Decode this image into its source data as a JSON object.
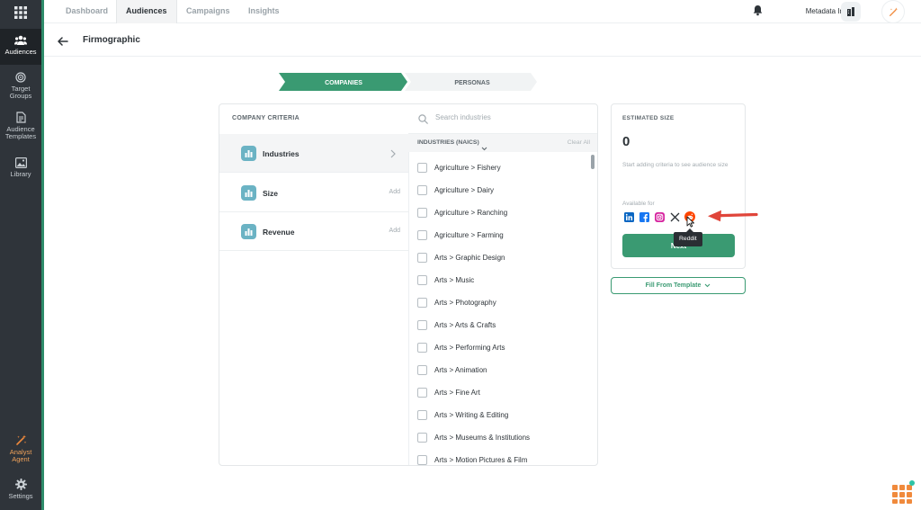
{
  "rail": {
    "items": [
      {
        "label": "Audiences"
      },
      {
        "label": "Target\nGroups"
      },
      {
        "label": "Audience\nTemplates"
      },
      {
        "label": "Library"
      },
      {
        "label": "Analyst\nAgent"
      },
      {
        "label": "Settings"
      }
    ]
  },
  "topnav": {
    "tabs": [
      "Dashboard",
      "Audiences",
      "Campaigns",
      "Insights"
    ],
    "org_name": "Metadata Inc"
  },
  "header": {
    "title": "Firmographic"
  },
  "steps": [
    "COMPANIES",
    "PERSONAS"
  ],
  "criteria": {
    "header": "COMPANY CRITERIA",
    "items": [
      {
        "label": "Industries",
        "action": ""
      },
      {
        "label": "Size",
        "action": "Add"
      },
      {
        "label": "Revenue",
        "action": "Add"
      }
    ]
  },
  "industries": {
    "search_placeholder": "Search industries",
    "dropdown_label": "INDUSTRIES (NAICS)",
    "clear_all": "Clear All",
    "items": [
      "Agriculture > Fishery",
      "Agriculture > Dairy",
      "Agriculture > Ranching",
      "Agriculture > Farming",
      "Arts > Graphic Design",
      "Arts > Music",
      "Arts > Photography",
      "Arts > Arts & Crafts",
      "Arts > Performing Arts",
      "Arts > Animation",
      "Arts > Fine Art",
      "Arts > Writing & Editing",
      "Arts > Museums & Institutions",
      "Arts > Motion Pictures & Film"
    ]
  },
  "estimate": {
    "header": "ESTIMATED SIZE",
    "value": "0",
    "hint": "Start adding criteria to see audience size",
    "available_label": "Available for",
    "tooltip": "Reddit",
    "next_label": "Next"
  },
  "template_button": "Fill From Template",
  "colors": {
    "rail": "#2f343a",
    "accent": "#3a9a72",
    "linkedin": "#0a66c2",
    "facebook": "#1877f2",
    "instagram": "#d6249f",
    "reddit": "#ff4500",
    "callout": "#e0453a"
  }
}
